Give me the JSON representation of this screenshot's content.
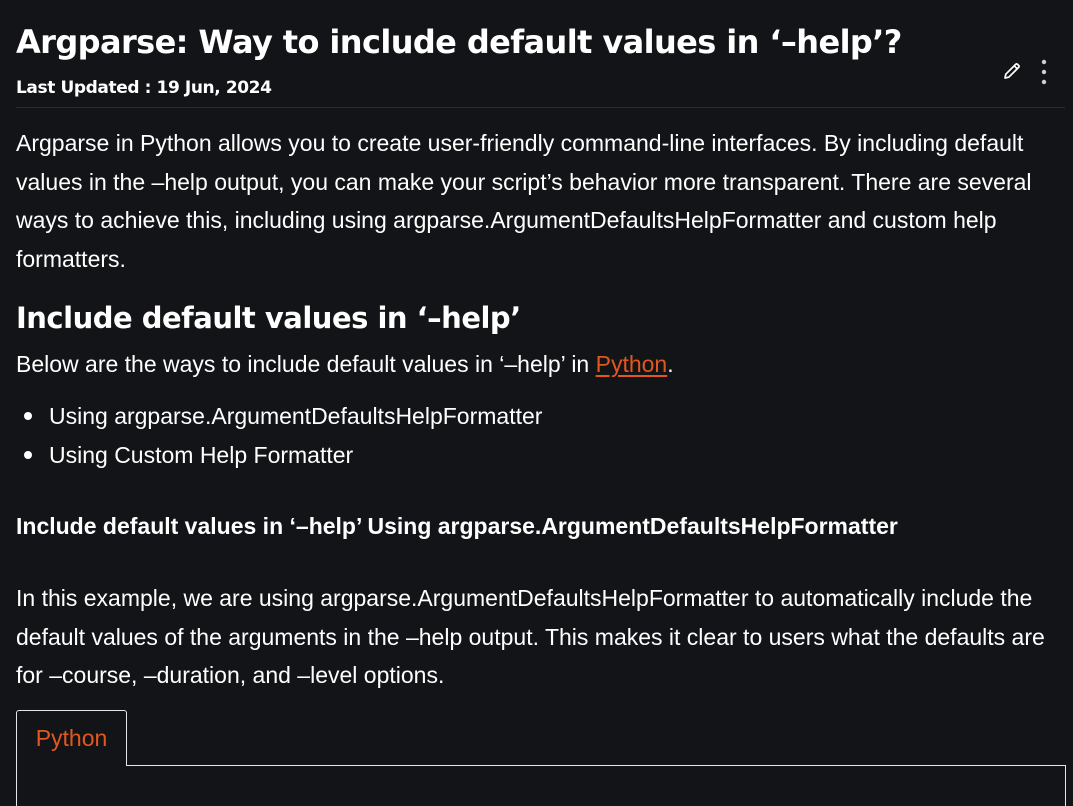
{
  "article": {
    "title": "Argparse: Way to include default values in ‘–help’?",
    "last_updated": "Last Updated : 19 Jun, 2024"
  },
  "toolbar": {
    "edit_icon": "pencil-icon",
    "more_icon": "vertical-dots-icon"
  },
  "content": {
    "intro": "Argparse in Python allows you to create user-friendly command-line interfaces. By including default values in the –help output, you can make your script’s behavior more transparent. There are several ways to achieve this, including using argparse.ArgumentDefaultsHelpFormatter and custom help formatters.",
    "heading": "Include default values in ‘–help’",
    "below_text_before": "Below are the ways to include default values in ‘–help’ in ",
    "below_link": "Python",
    "below_text_after": ".",
    "methods": [
      "Using argparse.ArgumentDefaultsHelpFormatter",
      "Using Custom Help Formatter"
    ],
    "subheading": "Include default values in ‘–help’ Using argparse.ArgumentDefaultsHelpFormatter",
    "example": "In this example, we are using argparse.ArgumentDefaultsHelpFormatter to automatically include the default values of the arguments in the –help output. This makes it clear to users what the defaults are for –course, –duration, and –level options."
  },
  "code_block": {
    "tabs": [
      "Python"
    ],
    "active_tab": "Python"
  },
  "colors": {
    "background": "#131417",
    "text": "#ffffff",
    "accent": "#e2571f",
    "divider": "#2a2c30"
  }
}
